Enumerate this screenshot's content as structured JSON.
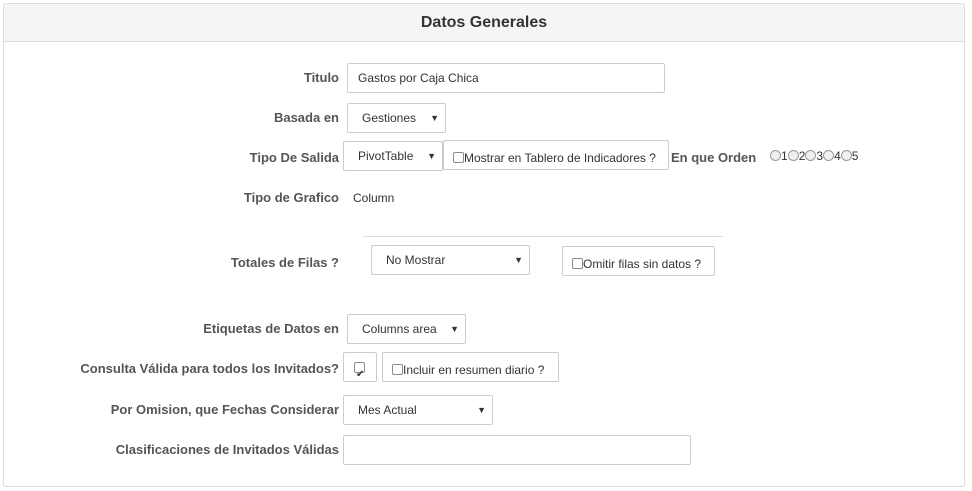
{
  "header": {
    "title": "Datos Generales"
  },
  "titulo": {
    "label": "Titulo",
    "value": "Gastos por Caja Chica"
  },
  "basada_en": {
    "label": "Basada en",
    "value": "Gestiones"
  },
  "tipo_salida": {
    "label": "Tipo De Salida",
    "value": "PivotTable"
  },
  "mostrar_tablero": {
    "label": "Mostrar en Tablero de Indicadores ?",
    "checked": false
  },
  "orden": {
    "label": "En que Orden",
    "options": [
      "1",
      "2",
      "3",
      "4",
      "5"
    ]
  },
  "tipo_grafico": {
    "label": "Tipo de Grafico",
    "value": "Column"
  },
  "totales_filas": {
    "label": "Totales de Filas ?",
    "value": "No Mostrar"
  },
  "omitir_filas": {
    "label": "Omitir filas sin datos ?",
    "checked": false
  },
  "etiquetas": {
    "label": "Etiquetas de Datos en",
    "value": "Columns area"
  },
  "consulta_valida": {
    "label": "Consulta Válida para todos los Invitados?",
    "checked": true
  },
  "incluir_resumen": {
    "label": "Incluir en resumen diario ?",
    "checked": false
  },
  "fechas": {
    "label": "Por Omision, que Fechas Considerar",
    "value": "Mes Actual"
  },
  "clasificaciones": {
    "label": "Clasificaciones de Invitados Válidas",
    "value": ""
  }
}
